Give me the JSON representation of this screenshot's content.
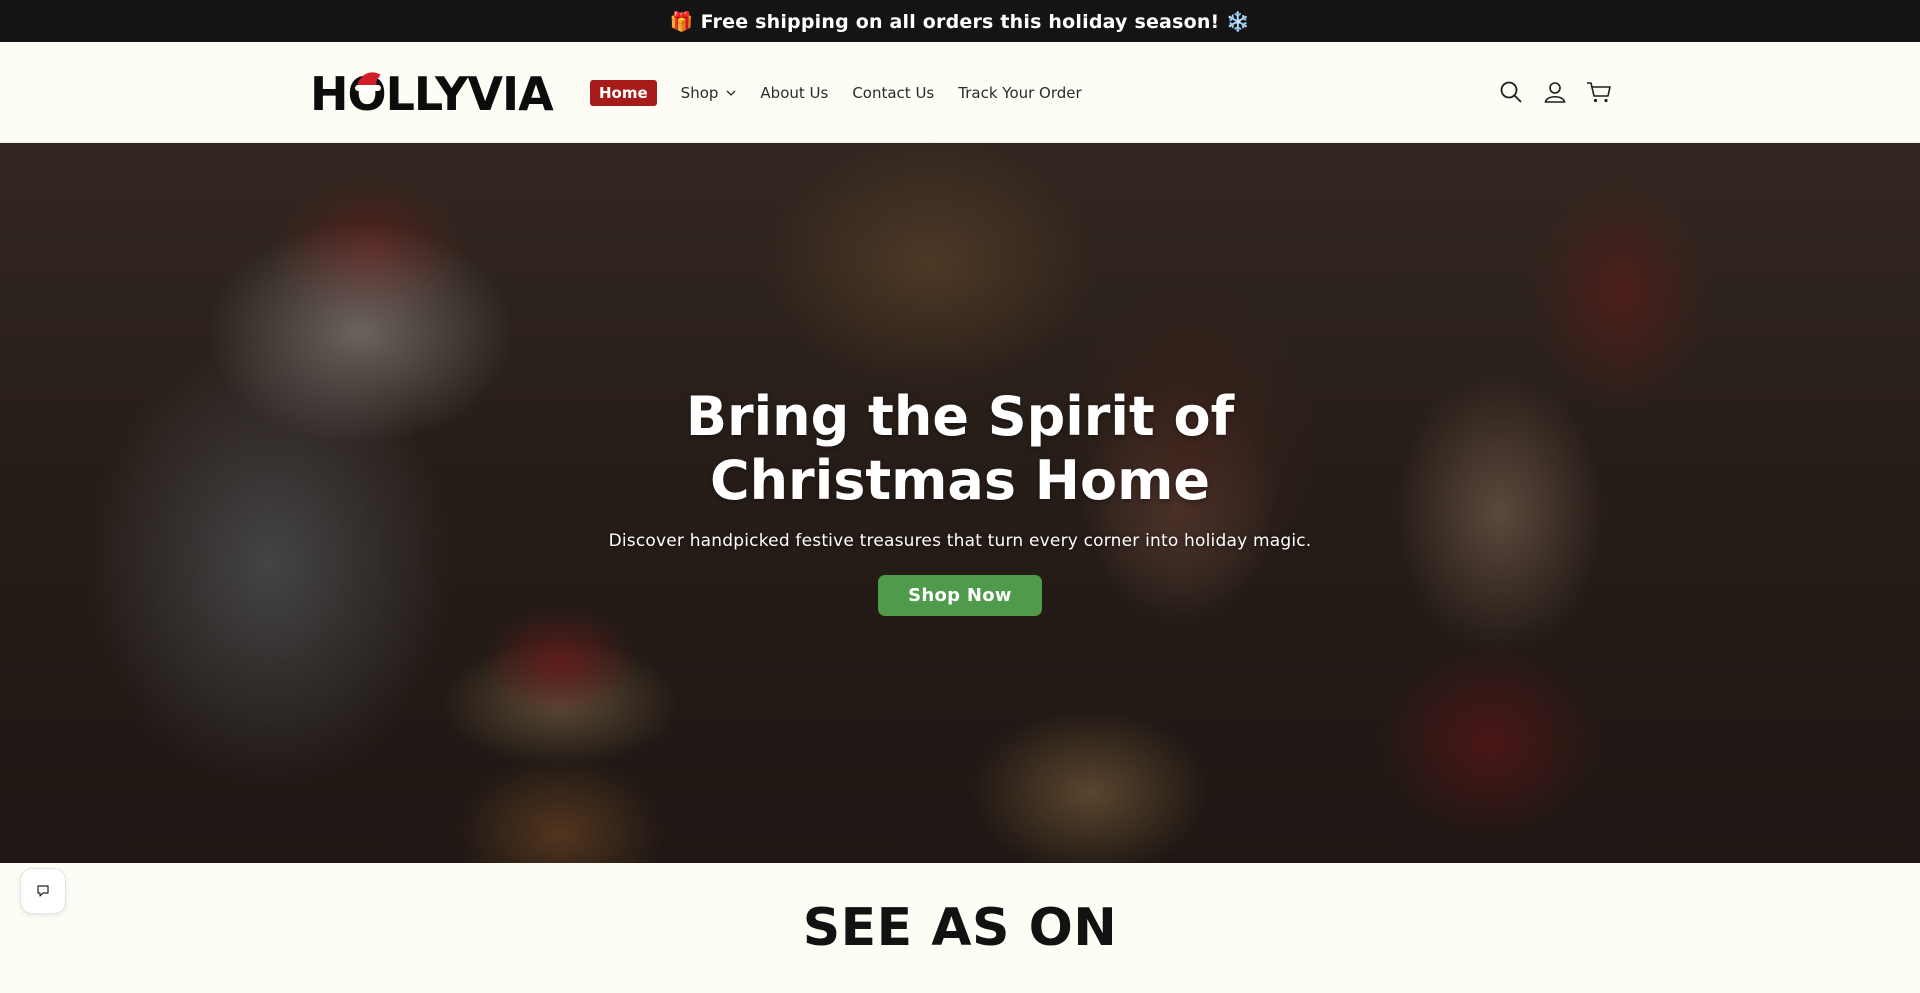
{
  "announcement": {
    "text": "🎁 Free shipping on all orders this holiday season! ❄️"
  },
  "header": {
    "logo_text": "HOLLYVIA",
    "nav": [
      {
        "label": "Home",
        "active": true
      },
      {
        "label": "Shop",
        "has_dropdown": true
      },
      {
        "label": "About Us"
      },
      {
        "label": "Contact Us"
      },
      {
        "label": "Track Your Order"
      }
    ],
    "icons": [
      "search-icon",
      "account-icon",
      "cart-icon"
    ]
  },
  "hero": {
    "title": "Bring the Spirit of Christmas Home",
    "subtitle": "Discover handpicked festive treasures that turn every corner into holiday magic.",
    "cta_label": "Shop Now"
  },
  "section": {
    "title": "SEE AS ON"
  },
  "colors": {
    "announcement_bg": "#141414",
    "nav_active_bg": "#a81b1b",
    "cta_bg": "#4f9a4b",
    "page_bg": "#fdfdf6"
  }
}
